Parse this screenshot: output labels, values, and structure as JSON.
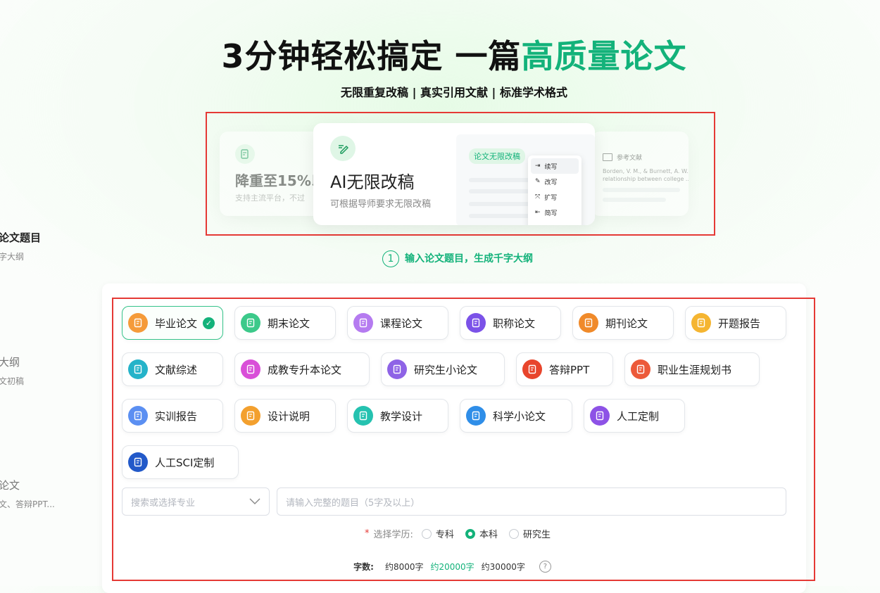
{
  "headline": {
    "part1": "3分钟轻松搞定 一篇",
    "highlight": "高质量论文"
  },
  "subline": "无限重复改稿 | 真实引用文献 | 标准学术格式",
  "left_steps": [
    {
      "title": "论文题目",
      "sub": "字大纲"
    },
    {
      "title": "大纲",
      "sub": "文初稿"
    },
    {
      "title": "论文",
      "sub": "文、答辩PPT..."
    }
  ],
  "carousel": {
    "left_card": {
      "title": "降重至15%以",
      "desc": "支持主流平台，不过"
    },
    "main_card": {
      "title": "AI无限改稿",
      "desc": "可根据导师要求无限改稿",
      "tag": "论文无限改稿"
    },
    "menu": [
      "续写",
      "改写",
      "扩写",
      "简写"
    ],
    "right_card": {
      "title": "参考文献",
      "line1": "Borden, V. M., & Burnett, A. W.",
      "line2": "relationship between college ..."
    }
  },
  "step": {
    "num": "1",
    "text": "输入论文题目，生成千字大纲"
  },
  "types": [
    {
      "label": "毕业论文",
      "color": "#f59b3a",
      "active": true
    },
    {
      "label": "期末论文",
      "color": "#3cc98a"
    },
    {
      "label": "课程论文",
      "color": "#b57bf0"
    },
    {
      "label": "职称论文",
      "color": "#7b52e8"
    },
    {
      "label": "期刊论文",
      "color": "#f08a2a"
    },
    {
      "label": "开题报告",
      "color": "#f5b531"
    },
    {
      "label": "文献综述",
      "color": "#25b3c9"
    },
    {
      "label": "成教专升本论文",
      "color": "#d94fd8"
    },
    {
      "label": "研究生小论文",
      "color": "#8e63e6"
    },
    {
      "label": "答辩PPT",
      "color": "#e8452c"
    },
    {
      "label": "职业生涯规划书",
      "color": "#ec5a3a"
    },
    {
      "label": "实训报告",
      "color": "#5b8ff2"
    },
    {
      "label": "设计说明",
      "color": "#f3a02e"
    },
    {
      "label": "教学设计",
      "color": "#25c2b0"
    },
    {
      "label": "科学小论文",
      "color": "#2f8ee8"
    },
    {
      "label": "人工定制",
      "color": "#8d52e6"
    },
    {
      "label": "人工SCI定制",
      "color": "#2259c9"
    }
  ],
  "major_select": {
    "placeholder": "搜索或选择专业"
  },
  "title_input": {
    "placeholder": "请输入完整的题目（5字及以上）"
  },
  "education": {
    "required": "*",
    "label": "选择学历:",
    "options": [
      "专科",
      "本科",
      "研究生"
    ],
    "selected": "本科"
  },
  "word_count": {
    "label": "字数:",
    "options": [
      "约8000字",
      "约20000字",
      "约30000字"
    ],
    "selected": "约20000字",
    "help": "?"
  }
}
